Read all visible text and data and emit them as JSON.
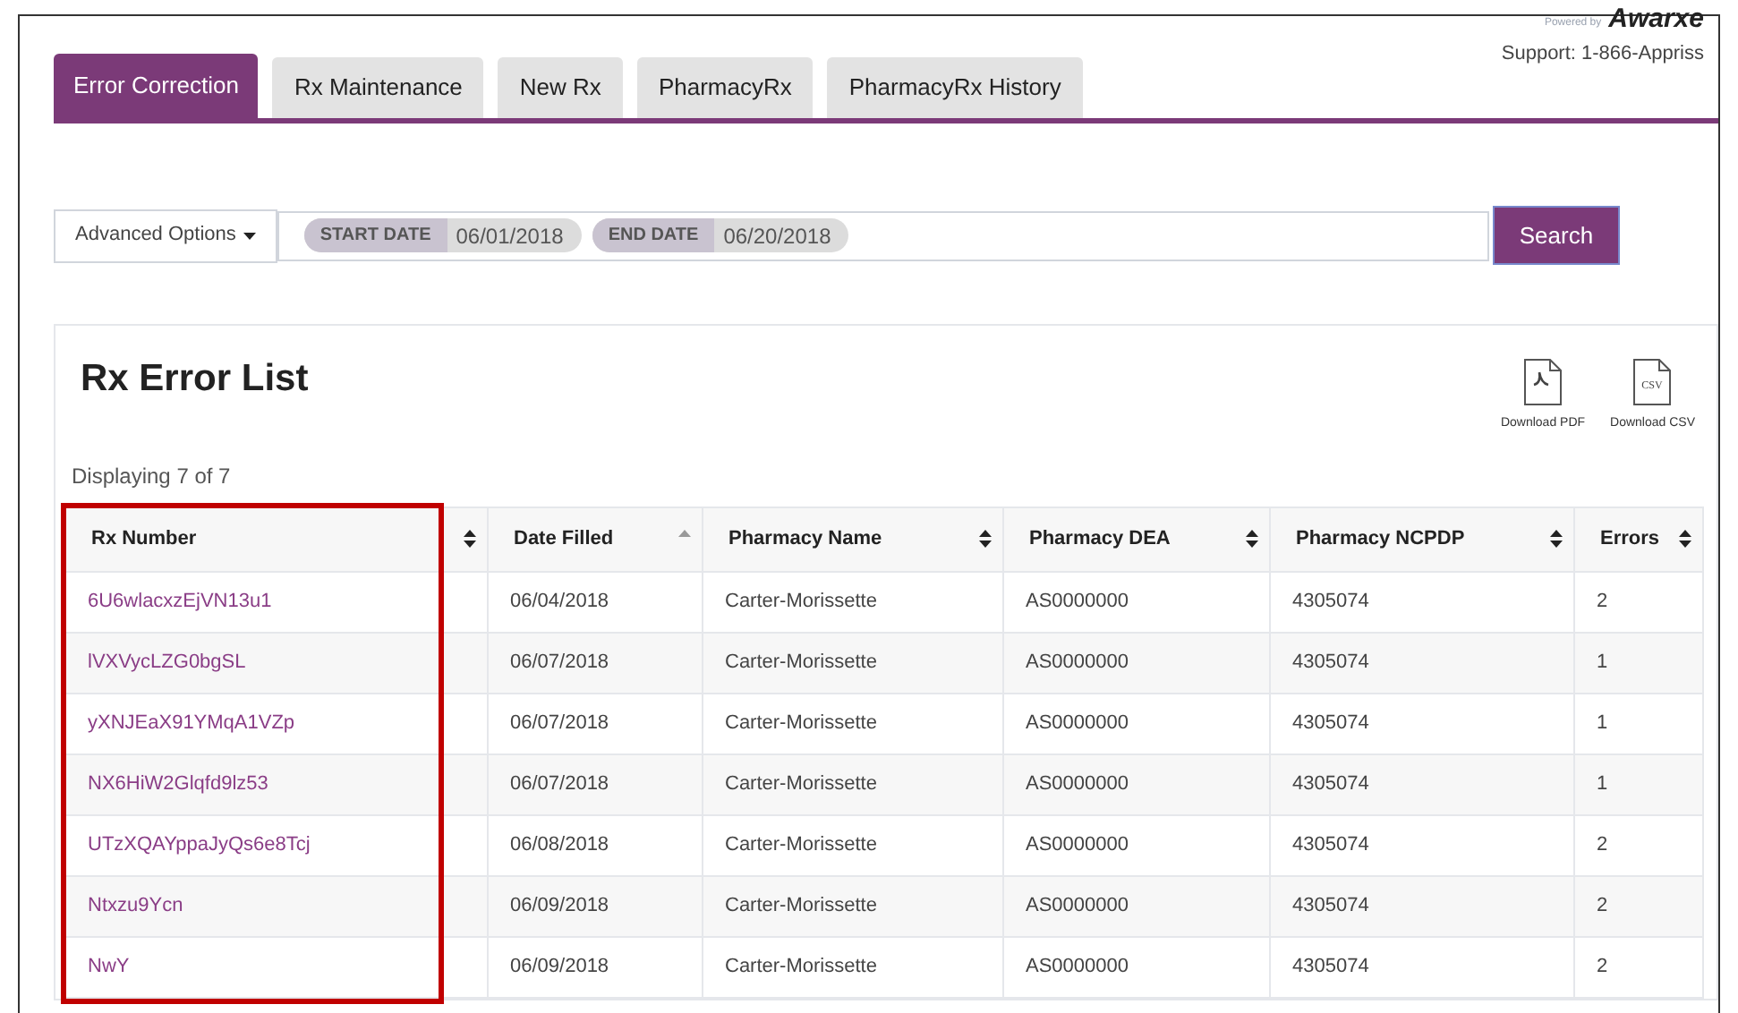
{
  "branding": {
    "powered_by": "Powered by",
    "logo": "Awarxe",
    "support": "Support: 1-866-Appriss"
  },
  "tabs": [
    {
      "label": "Error Correction",
      "selected": true
    },
    {
      "label": "Rx Maintenance",
      "selected": false
    },
    {
      "label": "New Rx",
      "selected": false
    },
    {
      "label": "PharmacyRx",
      "selected": false
    },
    {
      "label": "PharmacyRx History",
      "selected": false
    }
  ],
  "filter": {
    "advanced_options": "Advanced Options",
    "chips": [
      {
        "label": "START DATE",
        "value": "06/01/2018"
      },
      {
        "label": "END DATE",
        "value": "06/20/2018"
      }
    ],
    "search_button": "Search"
  },
  "list": {
    "title": "Rx Error List",
    "downloads": [
      {
        "kind": "pdf",
        "label": "Download PDF"
      },
      {
        "kind": "csv",
        "label": "Download CSV",
        "icon_text": "CSV"
      }
    ],
    "count": "Displaying 7 of 7",
    "columns": [
      {
        "label": "Rx Number",
        "sorted_ascending": false,
        "highlighted": true
      },
      {
        "label": "Date Filled",
        "sorted_ascending": true,
        "highlighted": false
      },
      {
        "label": "Pharmacy Name",
        "sorted_ascending": false,
        "highlighted": false
      },
      {
        "label": "Pharmacy DEA",
        "sorted_ascending": false,
        "highlighted": false
      },
      {
        "label": "Pharmacy NCPDP",
        "sorted_ascending": false,
        "highlighted": false
      },
      {
        "label": "Errors",
        "sorted_ascending": false,
        "highlighted": false
      }
    ],
    "rows": [
      [
        "6U6wlacxzEjVN13u1",
        "06/04/2018",
        "Carter-Morissette",
        "AS0000000",
        "4305074",
        "2"
      ],
      [
        "lVXVycLZG0bgSL",
        "06/07/2018",
        "Carter-Morissette",
        "AS0000000",
        "4305074",
        "1"
      ],
      [
        "yXNJEaX91YMqA1VZp",
        "06/07/2018",
        "Carter-Morissette",
        "AS0000000",
        "4305074",
        "1"
      ],
      [
        "NX6HiW2Glqfd9lz53",
        "06/07/2018",
        "Carter-Morissette",
        "AS0000000",
        "4305074",
        "1"
      ],
      [
        "UTzXQAYppaJyQs6e8Tcj",
        "06/08/2018",
        "Carter-Morissette",
        "AS0000000",
        "4305074",
        "2"
      ],
      [
        "Ntxzu9Ycn",
        "06/09/2018",
        "Carter-Morissette",
        "AS0000000",
        "4305074",
        "2"
      ],
      [
        "NwY",
        "06/09/2018",
        "Carter-Morissette",
        "AS0000000",
        "4305074",
        "2"
      ]
    ]
  }
}
